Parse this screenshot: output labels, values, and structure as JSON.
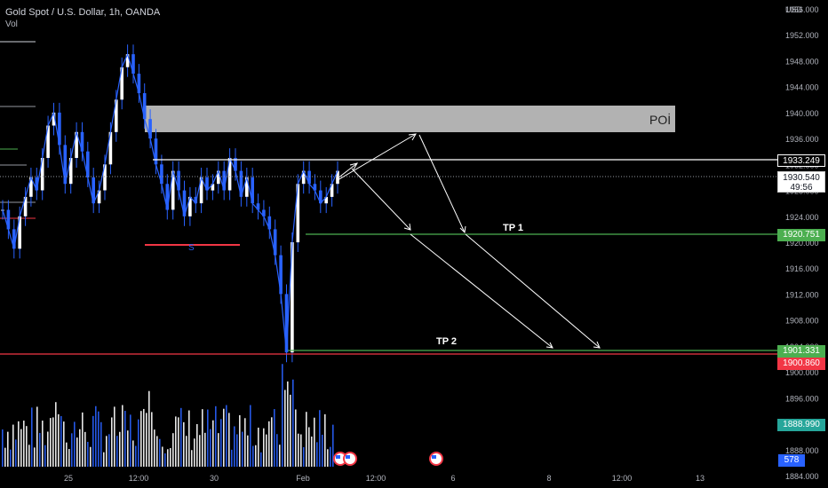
{
  "header": {
    "symbol": "Gold Spot / U.S. Dollar, 1h, OANDA",
    "volume_label": "Vol"
  },
  "price_axis": {
    "currency": "USD",
    "tags": {
      "level_white": "1933.249",
      "last_price": "1930.540",
      "countdown": "49:56",
      "tp1_level": "1920.751",
      "tp2_level": "1901.331",
      "support_red": "1900.860",
      "vol_green": "1888.990",
      "volume_value": "578"
    }
  },
  "annotations": {
    "poi_label": "POİ",
    "tp1_label": "TP 1",
    "tp2_label": "TP 2",
    "s_label": "S"
  },
  "colors": {
    "background": "#000000",
    "candle": "#2962ff",
    "volume": "#ffffff",
    "poi_zone": "#b2b2b2",
    "tp_line": "#4caf50",
    "support_line": "#f23645",
    "level_line": "#ffffff",
    "arrow": "#ffffff"
  },
  "chart_data": {
    "type": "line",
    "title": "Gold Spot / U.S. Dollar, 1h, OANDA",
    "xlabel": "",
    "ylabel": "",
    "y_unit": "USD",
    "ylim": [
      1882.5,
      1958.5
    ],
    "x_ticks": [
      "25",
      "12:00",
      "30",
      "Feb",
      "12:00",
      "6",
      "8",
      "12:00",
      "13"
    ],
    "y_ticks": [
      1956,
      1952,
      1948,
      1944,
      1940,
      1936,
      1932,
      1928,
      1924,
      1920,
      1916,
      1912,
      1908,
      1904,
      1900,
      1896,
      1892,
      1888,
      1884
    ],
    "series": [
      {
        "values": [
          1925,
          1922,
          1919,
          1924,
          1927,
          1930,
          1928,
          1933,
          1938,
          1940,
          1935,
          1929,
          1933,
          1937,
          1934,
          1930,
          1926,
          1928,
          1932,
          1937,
          1942,
          1947,
          1949,
          1946,
          1943,
          1939,
          1936,
          1932,
          1929,
          1925,
          1931,
          1928,
          1924,
          1927,
          1926,
          1930,
          1928,
          1929,
          1931,
          1928,
          1933,
          1931,
          1927,
          1930,
          1926,
          1925,
          1924,
          1922,
          1918,
          1912,
          1903,
          1920,
          1929,
          1931,
          1929,
          1928,
          1926,
          1927,
          1929,
          1931
        ]
      }
    ],
    "levels": [
      {
        "name": "POİ",
        "type": "zone",
        "from": 1938.0,
        "to": 1942.5
      },
      {
        "name": "level",
        "type": "line",
        "value": 1933.249
      },
      {
        "name": "TP 1",
        "type": "line",
        "value": 1920.751
      },
      {
        "name": "TP 2",
        "type": "line",
        "value": 1901.331
      },
      {
        "name": "support",
        "type": "line",
        "value": 1900.86
      },
      {
        "name": "S",
        "type": "line",
        "value": 1918.6
      }
    ]
  }
}
